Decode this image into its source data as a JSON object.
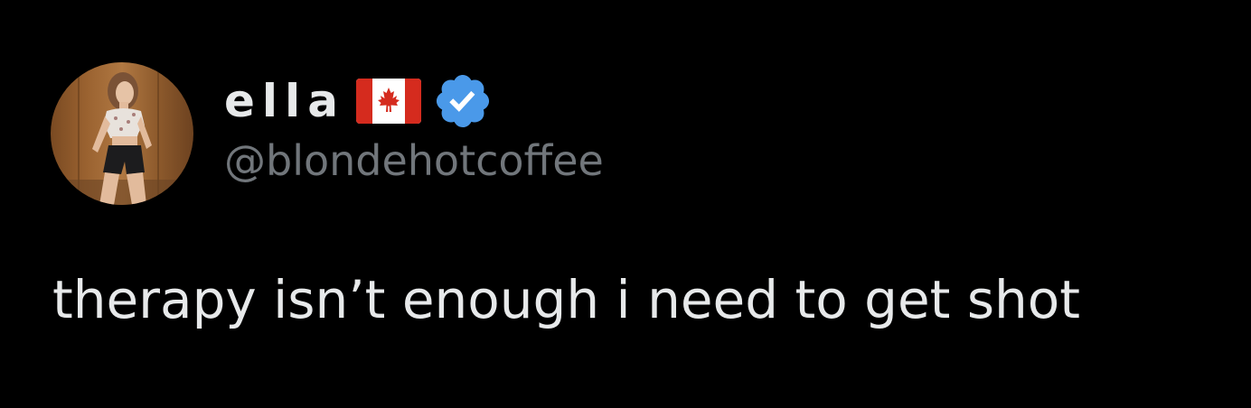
{
  "author": {
    "display_name": "ella",
    "handle": "@blondehotcoffee",
    "flag_icon": "canada-flag-icon",
    "verified_icon": "verified-badge-icon",
    "verified_color": "#4a99e9"
  },
  "tweet": {
    "text": "therapy isn’t enough i need to get shot"
  },
  "colors": {
    "background": "#000000",
    "primary_text": "#e7e9ea",
    "secondary_text": "#71767b",
    "flag_red": "#d52b1e"
  }
}
